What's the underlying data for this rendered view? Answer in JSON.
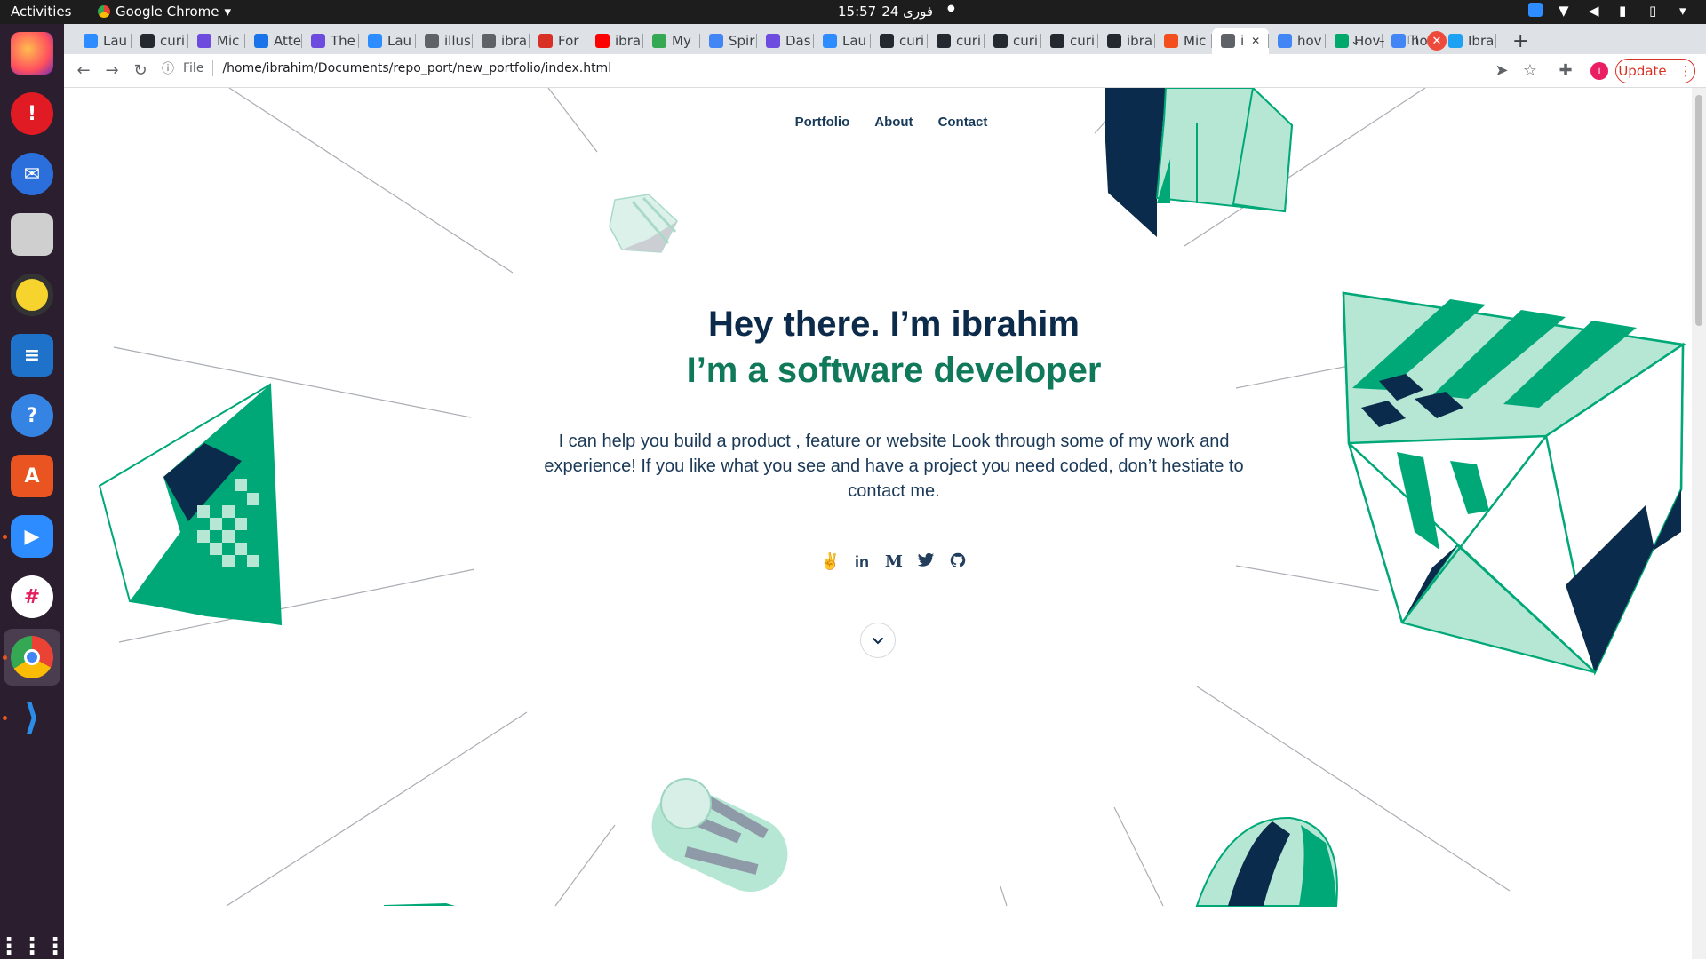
{
  "topbar": {
    "activities": "Activities",
    "app_name": "Google Chrome",
    "clock": "15:57",
    "date": "24 فوری",
    "dot": "●"
  },
  "dock": {
    "items": [
      "firefox",
      "alert",
      "thunderbird",
      "files",
      "rhythmbox",
      "writer",
      "help",
      "app-center",
      "zoom",
      "slack",
      "chrome",
      "vscode",
      "show-apps"
    ]
  },
  "tabs": [
    {
      "label": "Lau",
      "color": "#2d8cff"
    },
    {
      "label": "curi",
      "color": "#24292f"
    },
    {
      "label": "Mic",
      "color": "#6c4bde"
    },
    {
      "label": "Atte",
      "color": "#1a73e8"
    },
    {
      "label": "The",
      "color": "#6c4bde"
    },
    {
      "label": "Lau",
      "color": "#2d8cff"
    },
    {
      "label": "illus",
      "color": "#5f6368"
    },
    {
      "label": "ibra",
      "color": "#5f6368"
    },
    {
      "label": "For",
      "color": "#d93025"
    },
    {
      "label": "ibra",
      "color": "#ff0000"
    },
    {
      "label": "My",
      "color": "#34a853"
    },
    {
      "label": "Spir",
      "color": "#4285f4"
    },
    {
      "label": "Das",
      "color": "#6c4bde"
    },
    {
      "label": "Lau",
      "color": "#2d8cff"
    },
    {
      "label": "curi",
      "color": "#24292f"
    },
    {
      "label": "curi",
      "color": "#24292f"
    },
    {
      "label": "curi",
      "color": "#24292f"
    },
    {
      "label": "curi",
      "color": "#24292f"
    },
    {
      "label": "ibra",
      "color": "#24292f"
    },
    {
      "label": "Mic",
      "color": "#f24e1e"
    },
    {
      "label": "i",
      "color": "#5f6368",
      "active": true
    },
    {
      "label": "hov",
      "color": "#4285f4"
    },
    {
      "label": "Hov",
      "color": "#00a86b"
    },
    {
      "label": "hov",
      "color": "#4285f4"
    },
    {
      "label": "Ibra",
      "color": "#1da1f2"
    }
  ],
  "toolbar": {
    "file_label": "File",
    "url": "/home/ibrahim/Documents/repo_port/new_portfolio/index.html",
    "update_label": "Update",
    "profile_initial": "i"
  },
  "page": {
    "nav": [
      "Portfolio",
      "About",
      "Contact"
    ],
    "title": "Hey there. I’m ibrahim",
    "subtitle": "I’m a software developer",
    "intro": "I can help you build a product , feature or website Look through some of my work and experience! If you like what you see and have a project you need coded, don’t hestiate to contact me.",
    "socials": [
      "angellist-icon",
      "linkedin-icon",
      "medium-icon",
      "twitter-icon",
      "github-icon"
    ],
    "colors": {
      "navy": "#0c2b4b",
      "green": "#10795a",
      "mint": "#b6e7d4",
      "accent": "#00a878"
    }
  }
}
